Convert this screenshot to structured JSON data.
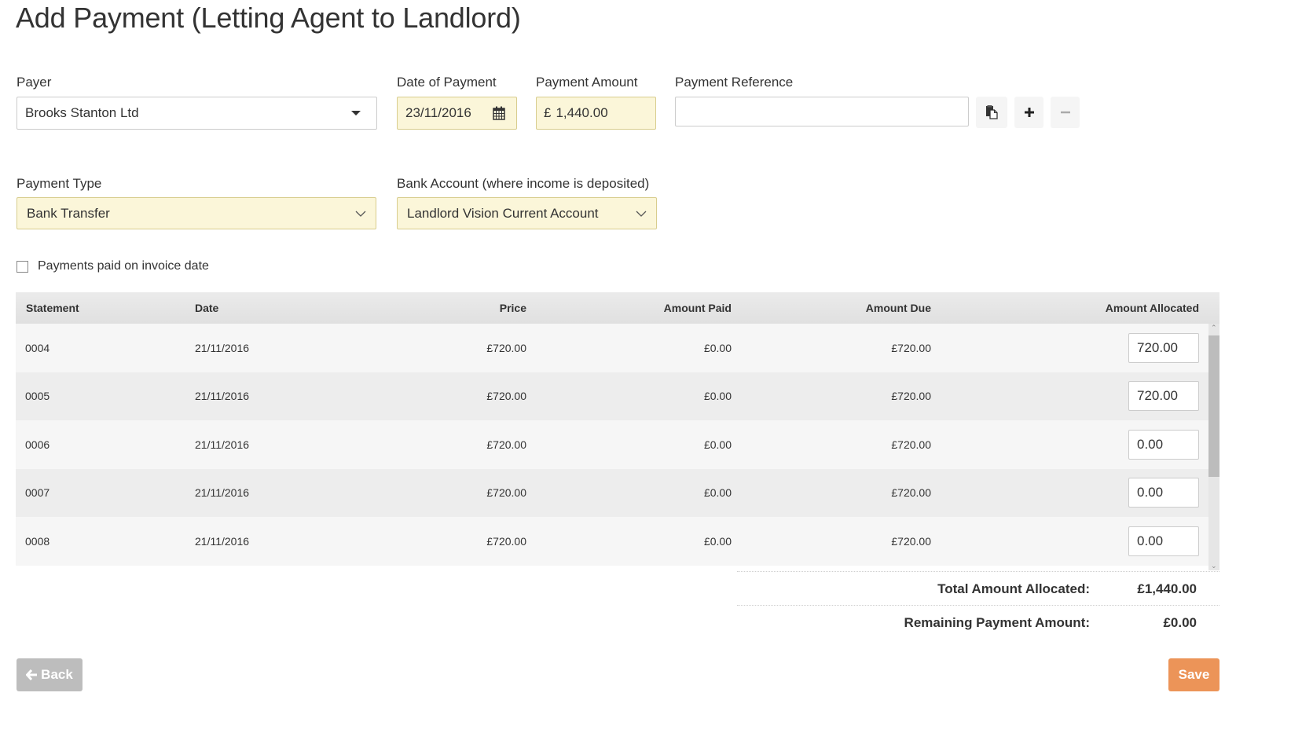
{
  "page": {
    "title": "Add Payment (Letting Agent to Landlord)"
  },
  "form": {
    "payer": {
      "label": "Payer",
      "value": "Brooks Stanton Ltd"
    },
    "date_of_payment": {
      "label": "Date of Payment",
      "value": "23/11/2016"
    },
    "payment_amount": {
      "label": "Payment Amount",
      "currency": "£",
      "value": "1,440.00"
    },
    "payment_reference": {
      "label": "Payment Reference",
      "value": ""
    },
    "payment_type": {
      "label": "Payment Type",
      "value": "Bank Transfer"
    },
    "bank_account": {
      "label": "Bank Account (where income is deposited)",
      "value": "Landlord Vision Current Account"
    },
    "paid_on_invoice_date": {
      "label": "Payments paid on invoice date",
      "checked": false
    }
  },
  "reference_actions": [
    {
      "icon": "paste-icon"
    },
    {
      "icon": "plus-icon"
    },
    {
      "icon": "minus-icon"
    }
  ],
  "table": {
    "columns": [
      "Statement",
      "Date",
      "Price",
      "Amount Paid",
      "Amount Due",
      "Amount Allocated"
    ],
    "rows": [
      {
        "statement": "0004",
        "date": "21/11/2016",
        "price": "£720.00",
        "paid": "£0.00",
        "due": "£720.00",
        "allocated": "720.00"
      },
      {
        "statement": "0005",
        "date": "21/11/2016",
        "price": "£720.00",
        "paid": "£0.00",
        "due": "£720.00",
        "allocated": "720.00"
      },
      {
        "statement": "0006",
        "date": "21/11/2016",
        "price": "£720.00",
        "paid": "£0.00",
        "due": "£720.00",
        "allocated": "0.00"
      },
      {
        "statement": "0007",
        "date": "21/11/2016",
        "price": "£720.00",
        "paid": "£0.00",
        "due": "£720.00",
        "allocated": "0.00"
      },
      {
        "statement": "0008",
        "date": "21/11/2016",
        "price": "£720.00",
        "paid": "£0.00",
        "due": "£720.00",
        "allocated": "0.00"
      }
    ]
  },
  "totals": {
    "allocated_label": "Total Amount Allocated:",
    "allocated_value": "£1,440.00",
    "remaining_label": "Remaining Payment Amount:",
    "remaining_value": "£0.00"
  },
  "buttons": {
    "back": "Back",
    "save": "Save"
  },
  "colors": {
    "save": "#ec9458",
    "back": "#bdbdbd",
    "highlight_field": "#fbf6d9"
  }
}
